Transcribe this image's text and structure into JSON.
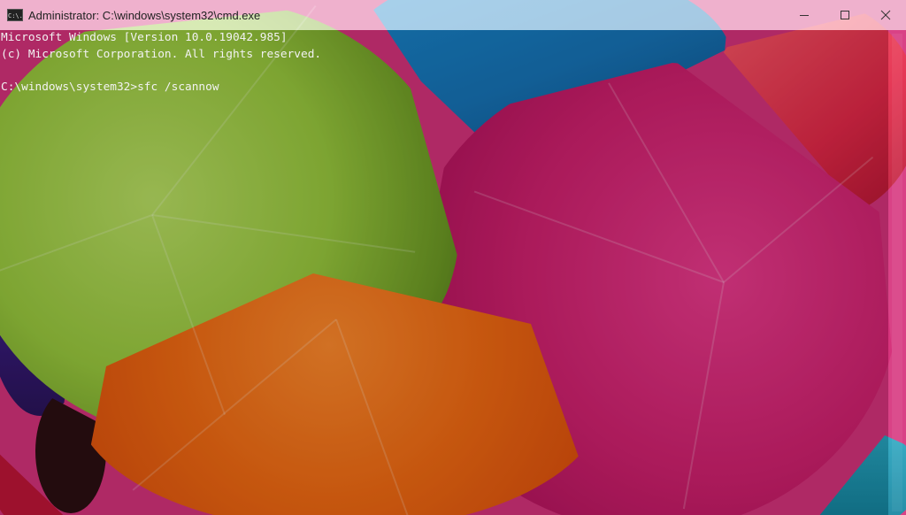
{
  "window": {
    "title": "Administrator: C:\\windows\\system32\\cmd.exe",
    "icon": "cmd-icon",
    "icon_label": "C:\\."
  },
  "controls": {
    "minimize_icon": "minimize-icon",
    "maximize_icon": "maximize-icon",
    "close_icon": "close-icon"
  },
  "console": {
    "lines": [
      "Microsoft Windows [Version 10.0.19042.985]",
      "(c) Microsoft Corporation. All rights reserved.",
      "",
      "C:\\windows\\system32>sfc /scannow"
    ]
  },
  "colors": {
    "text": "#f2f2f2",
    "titlebar": "#ffffffa0"
  }
}
